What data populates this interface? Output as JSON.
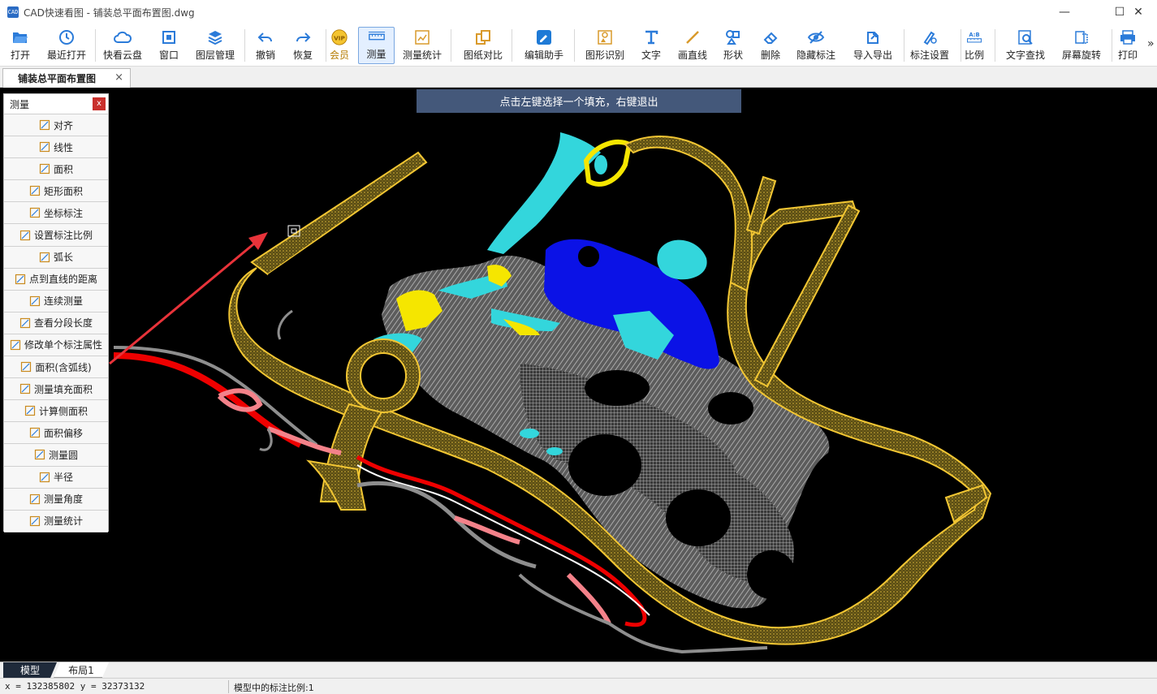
{
  "window": {
    "app_icon_text": "CAD",
    "title": "CAD快速看图 - 铺装总平面布置图.dwg",
    "controls": {
      "minimize": "—",
      "maximize": "☐",
      "close": "✕"
    }
  },
  "toolbar": {
    "items": [
      {
        "id": "open",
        "label": "打开",
        "icon": "folder-open-icon"
      },
      {
        "id": "recent",
        "label": "最近打开",
        "icon": "clock-history-icon"
      },
      {
        "id": "cloud",
        "label": "快看云盘",
        "icon": "cloud-icon"
      },
      {
        "id": "window",
        "label": "窗口",
        "icon": "window-icon"
      },
      {
        "id": "layers",
        "label": "图层管理",
        "icon": "layers-icon"
      },
      {
        "id": "undo",
        "label": "撤销",
        "icon": "undo-icon"
      },
      {
        "id": "redo",
        "label": "恢复",
        "icon": "redo-icon"
      },
      {
        "id": "vip",
        "label": "会员",
        "icon": "vip-badge-icon",
        "badge_text": "VIP"
      },
      {
        "id": "measure",
        "label": "测量",
        "icon": "ruler-icon",
        "active": true
      },
      {
        "id": "measure-stats",
        "label": "测量统计",
        "icon": "measure-stats-icon"
      },
      {
        "id": "compare",
        "label": "图纸对比",
        "icon": "compare-icon"
      },
      {
        "id": "edit-helper",
        "label": "编辑助手",
        "icon": "edit-helper-icon"
      },
      {
        "id": "shape-recognize",
        "label": "图形识别",
        "icon": "shape-recognize-icon"
      },
      {
        "id": "text",
        "label": "文字",
        "icon": "text-t-icon"
      },
      {
        "id": "line",
        "label": "画直线",
        "icon": "line-icon"
      },
      {
        "id": "shape",
        "label": "形状",
        "icon": "shape-icon"
      },
      {
        "id": "delete",
        "label": "删除",
        "icon": "eraser-icon"
      },
      {
        "id": "hide-annot",
        "label": "隐藏标注",
        "icon": "eye-hidden-icon"
      },
      {
        "id": "import-export",
        "label": "导入导出",
        "icon": "import-export-icon"
      },
      {
        "id": "annot-settings",
        "label": "标注设置",
        "icon": "annot-settings-icon"
      },
      {
        "id": "ratio",
        "label": "比例",
        "icon": "ratio-icon",
        "badge_text": "A:B"
      },
      {
        "id": "text-search",
        "label": "文字查找",
        "icon": "text-search-icon"
      },
      {
        "id": "rotate",
        "label": "屏幕旋转",
        "icon": "rotate-screen-icon"
      },
      {
        "id": "print",
        "label": "打印",
        "icon": "printer-icon"
      }
    ],
    "overflow": "»"
  },
  "tabs": {
    "document": "铺装总平面布置图",
    "close": "×"
  },
  "canvas": {
    "hint": "点击左键选择一个填充，右键退出",
    "colors": {
      "background": "#000000",
      "road": "#f2c633",
      "paving_gray": "#8e8e8e",
      "cyan": "#33d6dc",
      "blue": "#0b12e6",
      "yellow": "#f5e600",
      "red": "#ee0000",
      "pink": "#f4828a",
      "arrow": "#e8333a"
    }
  },
  "measure_panel": {
    "title": "测量",
    "close": "x",
    "items": [
      {
        "label": "对齐",
        "icon": "align-measure-icon"
      },
      {
        "label": "线性",
        "icon": "linear-measure-icon"
      },
      {
        "label": "面积",
        "icon": "area-icon"
      },
      {
        "label": "矩形面积",
        "icon": "rect-area-icon"
      },
      {
        "label": "坐标标注",
        "icon": "coordinate-icon"
      },
      {
        "label": "设置标注比例",
        "icon": "scale-ratio-icon"
      },
      {
        "label": "弧长",
        "icon": "arc-length-icon"
      },
      {
        "label": "点到直线的距离",
        "icon": "point-line-distance-icon"
      },
      {
        "label": "连续测量",
        "icon": "continuous-measure-icon"
      },
      {
        "label": "查看分段长度",
        "icon": "segment-length-icon"
      },
      {
        "label": "修改单个标注属性",
        "icon": "edit-annotation-icon"
      },
      {
        "label": "面积(含弧线)",
        "icon": "arc-area-icon"
      },
      {
        "label": "测量填充面积",
        "icon": "fill-area-icon"
      },
      {
        "label": "计算侧面积",
        "icon": "side-area-icon"
      },
      {
        "label": "面积偏移",
        "icon": "area-offset-icon"
      },
      {
        "label": "测量圆",
        "icon": "circle-measure-icon"
      },
      {
        "label": "半径",
        "icon": "radius-icon"
      },
      {
        "label": "测量角度",
        "icon": "angle-icon"
      },
      {
        "label": "测量统计",
        "icon": "stats-icon"
      }
    ]
  },
  "layout_tabs": {
    "model": "模型",
    "layout1": "布局1"
  },
  "status": {
    "coords": "x = 132385802  y = 32373132",
    "scale": "模型中的标注比例:1"
  }
}
